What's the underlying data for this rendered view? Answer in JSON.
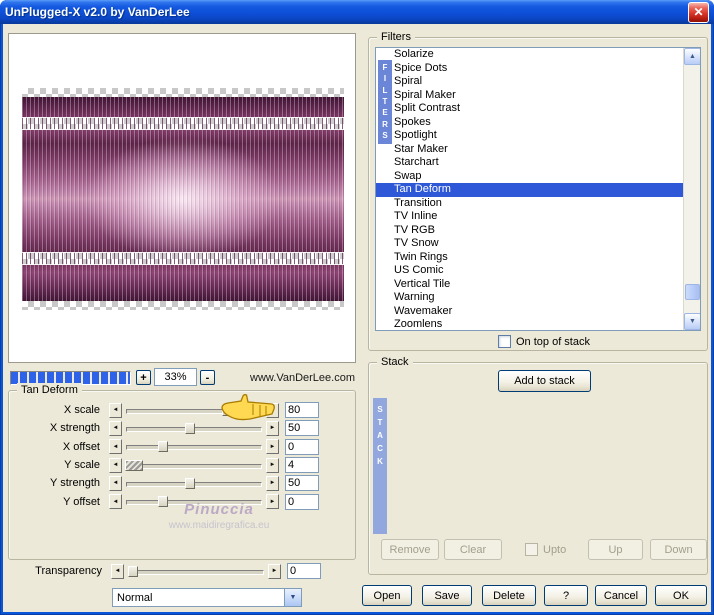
{
  "colors": {
    "dialog-bg": "#ECE9D8",
    "selection-blue": "#2E58D8",
    "filters-strip-blue": "#6B86D6",
    "stack-strip-blue": "#93A7DF",
    "progress-blue": "#2E62E8"
  },
  "glyphs": {
    "close": "✕",
    "arrow_left": "◄",
    "arrow_right": "►",
    "arrow_up": "▲",
    "arrow_down": "▼",
    "check": "✓"
  },
  "window": {
    "title": "UnPlugged-X v2.0 by VanDerLee"
  },
  "filters": {
    "group_label": "Filters",
    "vertical_label": "FILTERS",
    "selected": "Tan Deform",
    "items": [
      "Solarize",
      "Spice Dots",
      "Spiral",
      "Spiral Maker",
      "Split Contrast",
      "Spokes",
      "Spotlight",
      "Star Maker",
      "Starchart",
      "Swap",
      "Tan Deform",
      "Transition",
      "TV Inline",
      "TV RGB",
      "TV Snow",
      "Twin Rings",
      "US Comic",
      "Vertical Tile",
      "Warning",
      "Wavemaker",
      "Zoomlens"
    ],
    "on_top_label": "On top of stack",
    "on_top_checked": false
  },
  "zoom": {
    "plus": "+",
    "minus": "-",
    "value": "33%",
    "website": "www.VanDerLee.com"
  },
  "params": {
    "group_label": "Tan Deform",
    "sliders": [
      {
        "label": "X scale",
        "value": "80",
        "percent": 74
      },
      {
        "label": "X strength",
        "value": "50",
        "percent": 47
      },
      {
        "label": "X offset",
        "value": "0",
        "percent": 27
      },
      {
        "label": "Y scale",
        "value": "4",
        "percent": 3,
        "hatched": true
      },
      {
        "label": "Y strength",
        "value": "50",
        "percent": 47
      },
      {
        "label": "Y offset",
        "value": "0",
        "percent": 27
      }
    ],
    "watermark": "Pinuccia",
    "watermark_url": "www.maidiregrafica.eu"
  },
  "transparency": {
    "label": "Transparency",
    "value": "0",
    "percent": 4
  },
  "blend": {
    "value": "Normal"
  },
  "stack": {
    "group_label": "Stack",
    "add_button": "Add to stack",
    "vertical_label": "STACK",
    "remove_button": "Remove",
    "clear_button": "Clear",
    "upto_label": "Upto",
    "upto_checked": false,
    "up_button": "Up",
    "down_button": "Down"
  },
  "footer": {
    "open": "Open",
    "save": "Save",
    "delete": "Delete",
    "help": "?",
    "cancel": "Cancel",
    "ok": "OK"
  }
}
